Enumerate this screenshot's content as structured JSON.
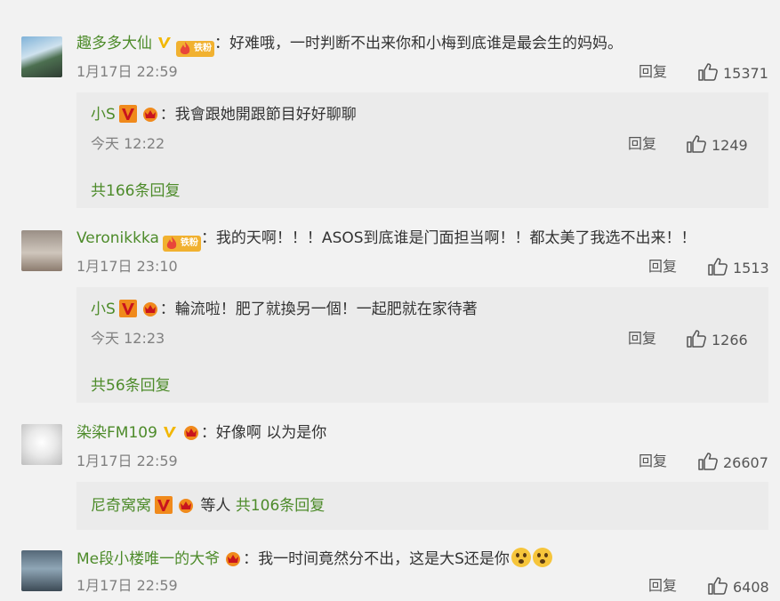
{
  "comments": [
    {
      "username": "趣多多大仙",
      "badge_text": "铁粉",
      "text": "：好难哦，一时判断不出来你和小梅到底谁是最会生的妈妈。",
      "date": "1月17日 22:59",
      "reply_label": "回复",
      "likes": "15371",
      "reply": {
        "username": "小S",
        "text": "：我會跟她開跟節目好好聊聊",
        "date": "今天 12:22",
        "reply_label": "回复",
        "likes": "1249"
      },
      "more_replies": "共166条回复"
    },
    {
      "username": "Veronikkka",
      "badge_text": "铁粉",
      "text": "：我的天啊！！！ASOS到底谁是门面担当啊！！都太美了我选不出来！！",
      "date": "1月17日 23:10",
      "reply_label": "回复",
      "likes": "1513",
      "reply": {
        "username": "小S",
        "text": "：輪流啦！肥了就換另一個！一起肥就在家待著",
        "date": "今天 12:23",
        "reply_label": "回复",
        "likes": "1266"
      },
      "more_replies": "共56条回复"
    },
    {
      "username": "染染FM109",
      "text": "：好像啊 以为是你",
      "date": "1月17日 22:59",
      "reply_label": "回复",
      "likes": "26607",
      "summary": {
        "username": "尼奇窝窝",
        "text": "等人",
        "count": "共106条回复"
      }
    },
    {
      "username": "Me段小楼唯一的大爷",
      "text": "：我一时间竟然分不出，这是大S还是你",
      "date": "1月17日 22:59",
      "reply_label": "回复",
      "likes": "6408"
    }
  ],
  "colors": {
    "username": "#4d8b2a",
    "meta": "#808080",
    "reply_box": "#ebebeb",
    "background": "#f2f2f2"
  }
}
